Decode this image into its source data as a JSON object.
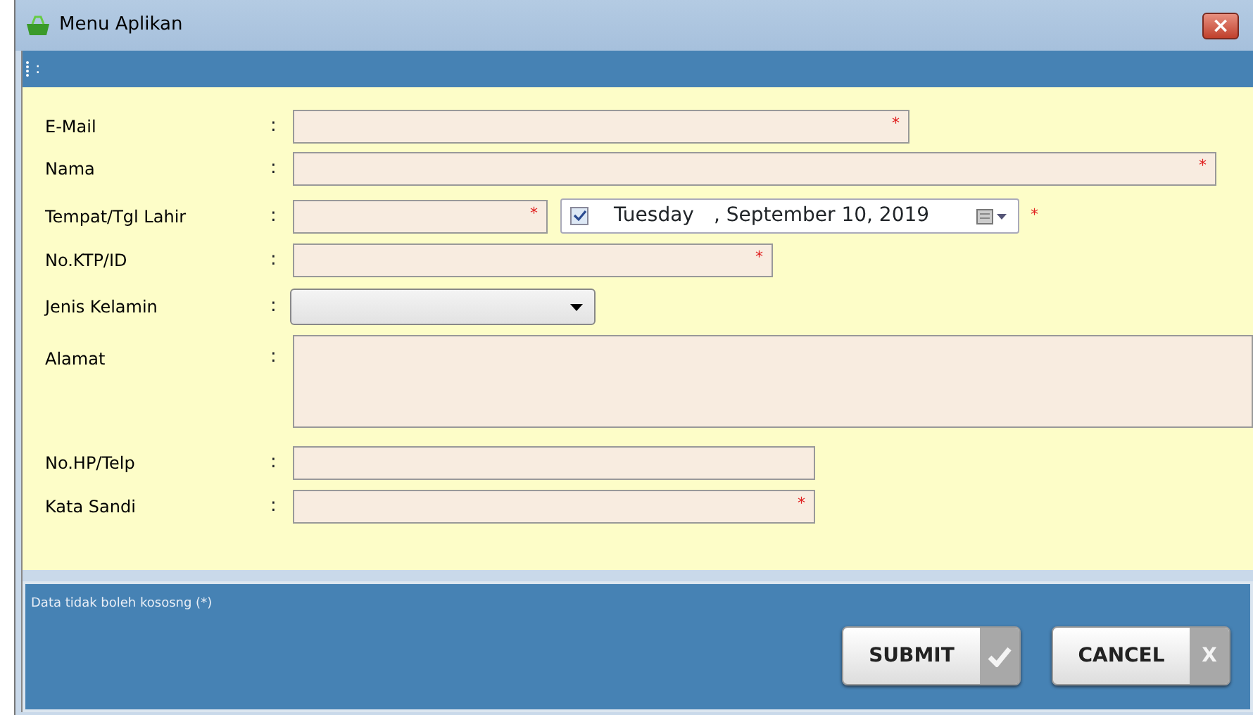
{
  "window": {
    "title": "Menu Aplikan",
    "close_glyph": "×"
  },
  "toolbar": {
    "text": ":"
  },
  "fields": [
    {
      "kind": "text",
      "label": "E-Mail",
      "colon": ":",
      "required_mark": "*"
    },
    {
      "kind": "text",
      "label": "Nama",
      "colon": ":",
      "required_mark": "*"
    },
    {
      "kind": "text",
      "label": "Tempat/Tgl Lahir",
      "colon": ":",
      "required_mark": "*",
      "date": {
        "checked": true,
        "day": "Tuesday",
        "date": ", September 10, 2019",
        "required_mark": "*"
      }
    },
    {
      "kind": "text",
      "label": "No.KTP/ID",
      "colon": ":",
      "required_mark": "*"
    },
    {
      "kind": "select",
      "label": "Jenis Kelamin",
      "colon": ":"
    },
    {
      "kind": "textarea",
      "label": "Alamat",
      "colon": ":"
    },
    {
      "kind": "text",
      "label": "No.HP/Telp",
      "colon": ":"
    },
    {
      "kind": "text",
      "label": "Kata Sandi",
      "colon": ":",
      "required_mark": "*"
    }
  ],
  "footer": {
    "note": "Data tidak boleh kososng (*)"
  },
  "buttons": [
    {
      "kind": "submit",
      "label": "SUBMIT"
    },
    {
      "kind": "cancel",
      "label": "CANCEL",
      "glyph": "X"
    }
  ]
}
